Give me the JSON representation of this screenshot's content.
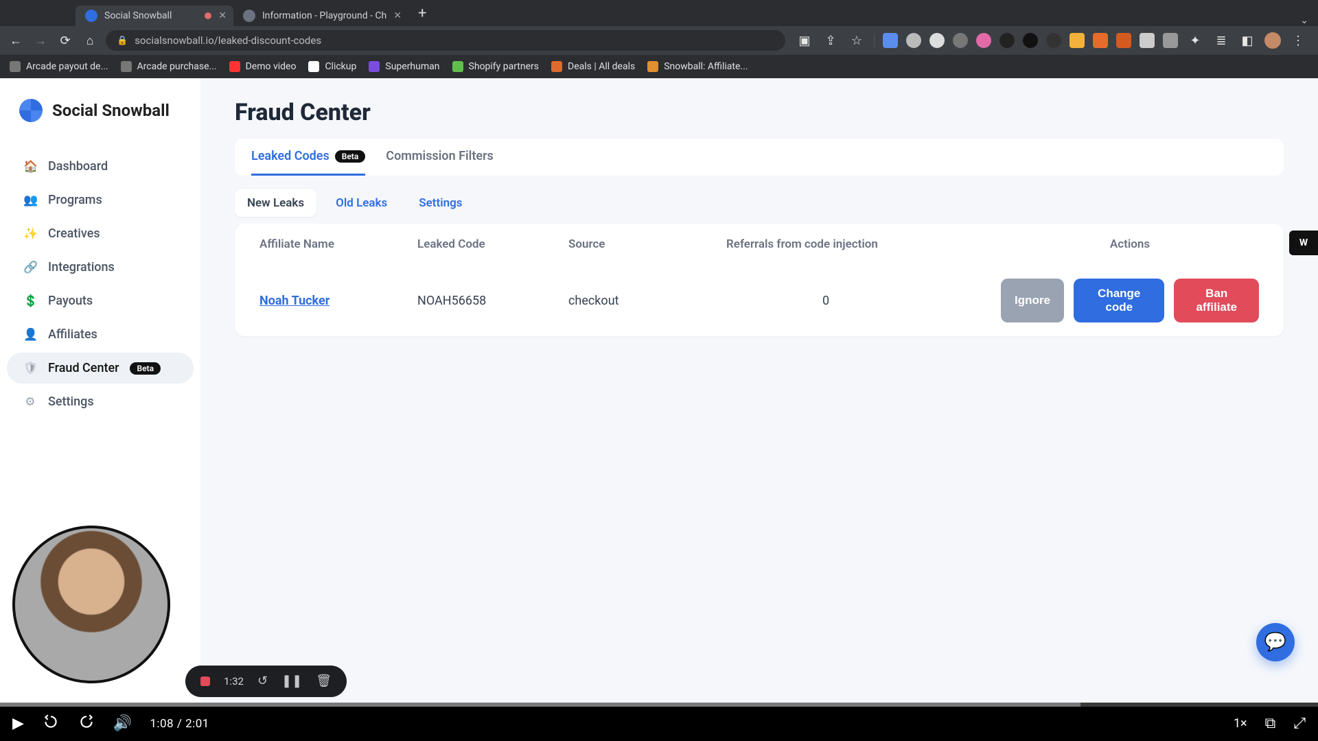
{
  "browser": {
    "tabs": [
      {
        "title": "Social Snowball",
        "active": true
      },
      {
        "title": "Information - Playground - Ch",
        "active": false
      }
    ],
    "url": "socialsnowball.io/leaked-discount-codes",
    "bookmarks": [
      {
        "label": "Arcade payout de..."
      },
      {
        "label": "Arcade purchase..."
      },
      {
        "label": "Demo video"
      },
      {
        "label": "Clickup"
      },
      {
        "label": "Superhuman"
      },
      {
        "label": "Shopify partners"
      },
      {
        "label": "Deals | All deals"
      },
      {
        "label": "Snowball: Affiliate..."
      }
    ]
  },
  "brand": "Social Snowball",
  "sidebar": {
    "items": [
      {
        "label": "Dashboard",
        "icon": "🏠"
      },
      {
        "label": "Programs",
        "icon": "👥"
      },
      {
        "label": "Creatives",
        "icon": "✨"
      },
      {
        "label": "Integrations",
        "icon": "🔗"
      },
      {
        "label": "Payouts",
        "icon": "💲"
      },
      {
        "label": "Affiliates",
        "icon": "👤"
      },
      {
        "label": "Fraud Center",
        "icon": "🛡",
        "active": true,
        "badge": "Beta"
      },
      {
        "label": "Settings",
        "icon": "⚙"
      }
    ]
  },
  "page": {
    "title": "Fraud Center",
    "tabs": [
      {
        "label": "Leaked Codes",
        "active": true,
        "badge": "Beta"
      },
      {
        "label": "Commission Filters"
      }
    ],
    "subtabs": [
      {
        "label": "New Leaks",
        "active": true
      },
      {
        "label": "Old Leaks"
      },
      {
        "label": "Settings"
      }
    ],
    "columns": {
      "affiliate": "Affiliate Name",
      "code": "Leaked Code",
      "source": "Source",
      "referrals": "Referrals from code injection",
      "actions": "Actions"
    },
    "rows": [
      {
        "affiliate": "Noah Tucker",
        "code": "NOAH56658",
        "source": "checkout",
        "referrals": "0"
      }
    ],
    "buttons": {
      "ignore": "Ignore",
      "change": "Change code",
      "ban": "Ban affiliate"
    }
  },
  "recorder": {
    "time": "1:32"
  },
  "player": {
    "current": "1:08",
    "total": "2:01",
    "played_pct": 56,
    "buffered_pct": 82,
    "speed": "1×"
  },
  "side_tab": "W"
}
